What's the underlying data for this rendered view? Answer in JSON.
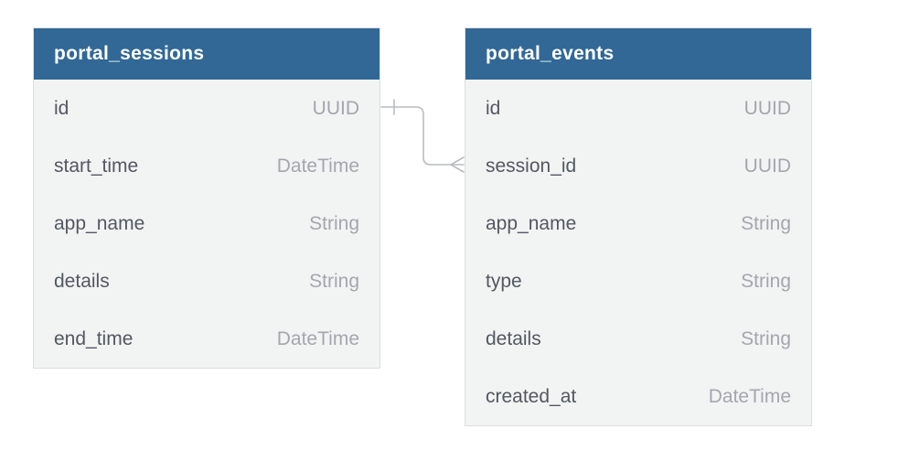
{
  "tables": {
    "sessions": {
      "title": "portal_sessions",
      "fields": [
        {
          "name": "id",
          "type": "UUID"
        },
        {
          "name": "start_time",
          "type": "DateTime"
        },
        {
          "name": "app_name",
          "type": "String"
        },
        {
          "name": "details",
          "type": "String"
        },
        {
          "name": "end_time",
          "type": "DateTime"
        }
      ]
    },
    "events": {
      "title": "portal_events",
      "fields": [
        {
          "name": "id",
          "type": "UUID"
        },
        {
          "name": "session_id",
          "type": "UUID"
        },
        {
          "name": "app_name",
          "type": "String"
        },
        {
          "name": "type",
          "type": "String"
        },
        {
          "name": "details",
          "type": "String"
        },
        {
          "name": "created_at",
          "type": "DateTime"
        }
      ]
    }
  },
  "relationship": {
    "from_table": "portal_sessions",
    "from_field": "id",
    "from_cardinality": "one",
    "to_table": "portal_events",
    "to_field": "session_id",
    "to_cardinality": "many"
  },
  "colors": {
    "header_bg": "#316896",
    "header_text": "#ffffff",
    "row_bg": "#f2f3f3",
    "field_name": "#525861",
    "field_type": "#a3a7ad",
    "border": "#dddee0",
    "connector": "#b8bcc1"
  }
}
